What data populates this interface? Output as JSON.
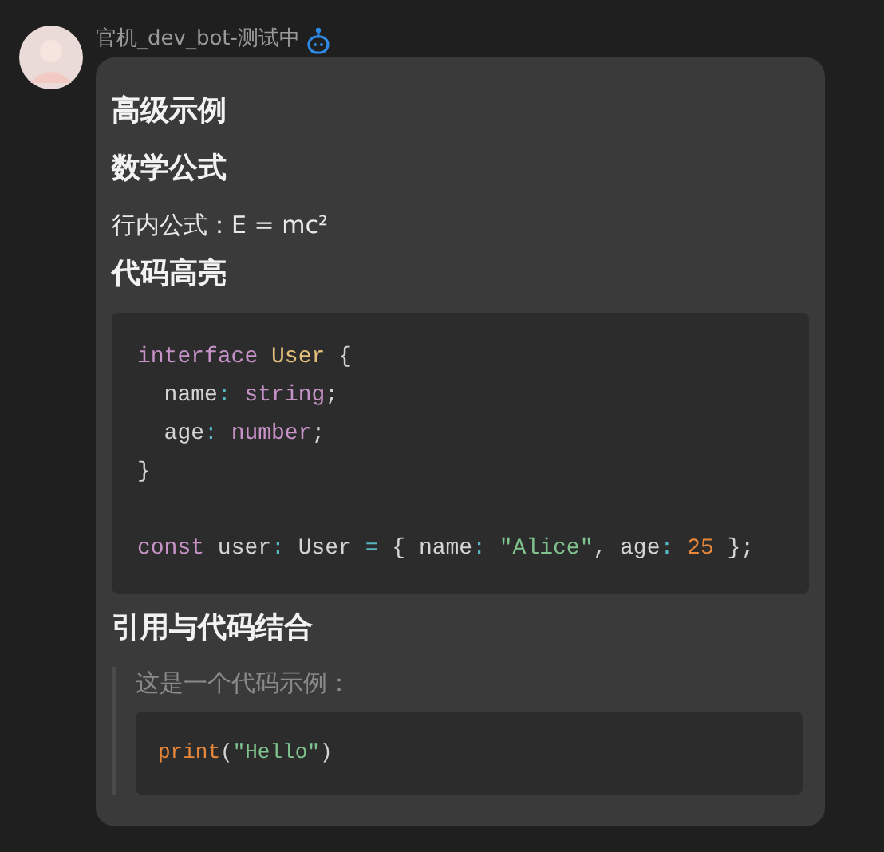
{
  "sender": {
    "name": "官机_dev_bot-测试中"
  },
  "blocks": [
    {
      "kind": "heading",
      "text": "高级示例"
    },
    {
      "kind": "heading",
      "text": "数学公式"
    },
    {
      "kind": "paragraph",
      "text": "行内公式：E = mc²"
    },
    {
      "kind": "heading",
      "text": "代码高亮"
    },
    {
      "kind": "code",
      "lines": [
        {
          "kind": "code",
          "tokens": [
            {
              "t": "interface",
              "kind": "keyword"
            },
            {
              "t": " User",
              "kind": "type"
            },
            {
              "t": " {",
              "kind": "plain"
            }
          ]
        },
        {
          "kind": "code",
          "tokens": [
            {
              "t": "  name",
              "kind": "plain"
            },
            {
              "t": ": ",
              "kind": "operator"
            },
            {
              "t": "string",
              "kind": "keyword"
            },
            {
              "t": ";",
              "kind": "plain"
            }
          ]
        },
        {
          "kind": "code",
          "tokens": [
            {
              "t": "  age",
              "kind": "plain"
            },
            {
              "t": ": ",
              "kind": "operator"
            },
            {
              "t": "number",
              "kind": "keyword"
            },
            {
              "t": ";",
              "kind": "plain"
            }
          ]
        },
        {
          "kind": "code",
          "tokens": [
            {
              "t": "}",
              "kind": "plain"
            }
          ]
        },
        {
          "kind": "blank"
        },
        {
          "kind": "code",
          "tokens": [
            {
              "t": "const",
              "kind": "keyword"
            },
            {
              "t": " user",
              "kind": "plain"
            },
            {
              "t": ": ",
              "kind": "operator"
            },
            {
              "t": "User ",
              "kind": "plain"
            },
            {
              "t": "= ",
              "kind": "operator"
            },
            {
              "t": "{ name",
              "kind": "plain"
            },
            {
              "t": ": ",
              "kind": "operator"
            },
            {
              "t": "\"Alice\"",
              "kind": "string"
            },
            {
              "t": ", age",
              "kind": "plain"
            },
            {
              "t": ": ",
              "kind": "operator"
            },
            {
              "t": "25",
              "kind": "number"
            },
            {
              "t": " };",
              "kind": "plain"
            }
          ]
        }
      ]
    },
    {
      "kind": "heading",
      "text": "引用与代码结合"
    },
    {
      "kind": "quote",
      "text": "这是一个代码示例：",
      "lines": [
        {
          "kind": "code",
          "tokens": [
            {
              "t": "print",
              "kind": "function"
            },
            {
              "t": "(",
              "kind": "plain"
            },
            {
              "t": "\"Hello\"",
              "kind": "string"
            },
            {
              "t": ")",
              "kind": "plain"
            }
          ]
        }
      ]
    }
  ]
}
